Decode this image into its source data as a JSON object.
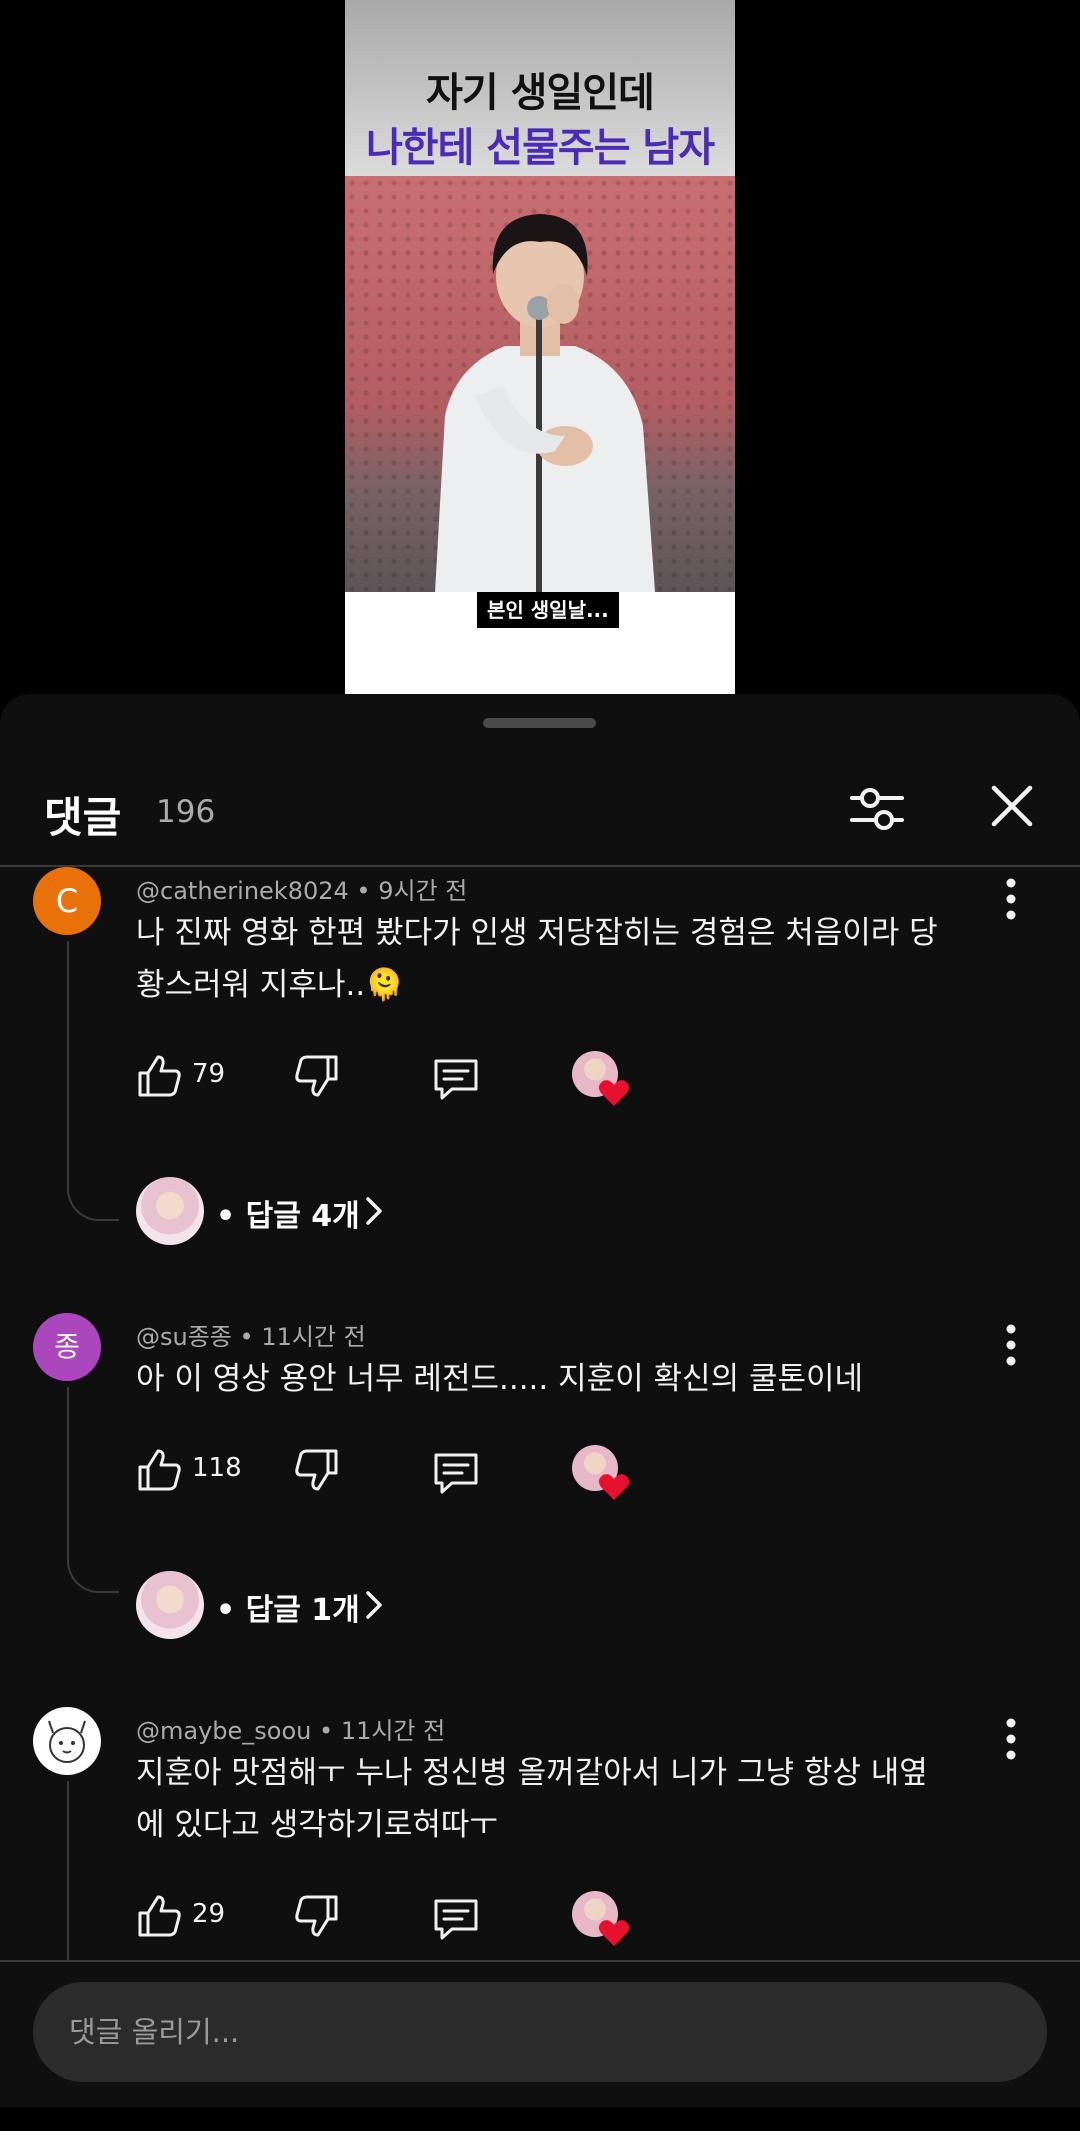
{
  "video": {
    "title_line1": "자기 생일인데",
    "title_line2": "나한테 선물주는 남자",
    "caption": "본인 생일날...",
    "title_line2_color": "#4b2bb6"
  },
  "comments_panel": {
    "title": "댓글",
    "count": "196",
    "icons": {
      "filter": "sliders-icon",
      "close": "close-icon"
    }
  },
  "comments": [
    {
      "author": "@catherinek8024",
      "time": "9시간 전",
      "text": "나 진짜 영화 한편 봤다가 인생 저당잡히는 경험은 처음이라 당황스러워 지후나..🫠",
      "likes": "79",
      "avatar_letter": "C",
      "avatar_color": "#e8710a",
      "replies_label": "• 답글 4개"
    },
    {
      "author": "@su종종",
      "time": "11시간 전",
      "text": "아 이 영상 용안 너무 레전드..... 지훈이 확신의 쿨톤이네",
      "likes": "118",
      "avatar_letter": "종",
      "avatar_color": "#ab47bc",
      "replies_label": "• 답글 1개"
    },
    {
      "author": "@maybe_soou",
      "time": "11시간 전",
      "text": "지훈아 맛점해ㅜ 누나 정신병 올꺼같아서 니가 그냥 항상 내옆에 있다고 생각하기로혀따ㅜ",
      "likes": "29",
      "avatar_letter": "",
      "avatar_color": "#ffffff"
    }
  ],
  "composer": {
    "placeholder": "댓글 올리기..."
  },
  "colors": {
    "sheet_bg": "#0f0f0f",
    "heart": "#e8112d"
  }
}
